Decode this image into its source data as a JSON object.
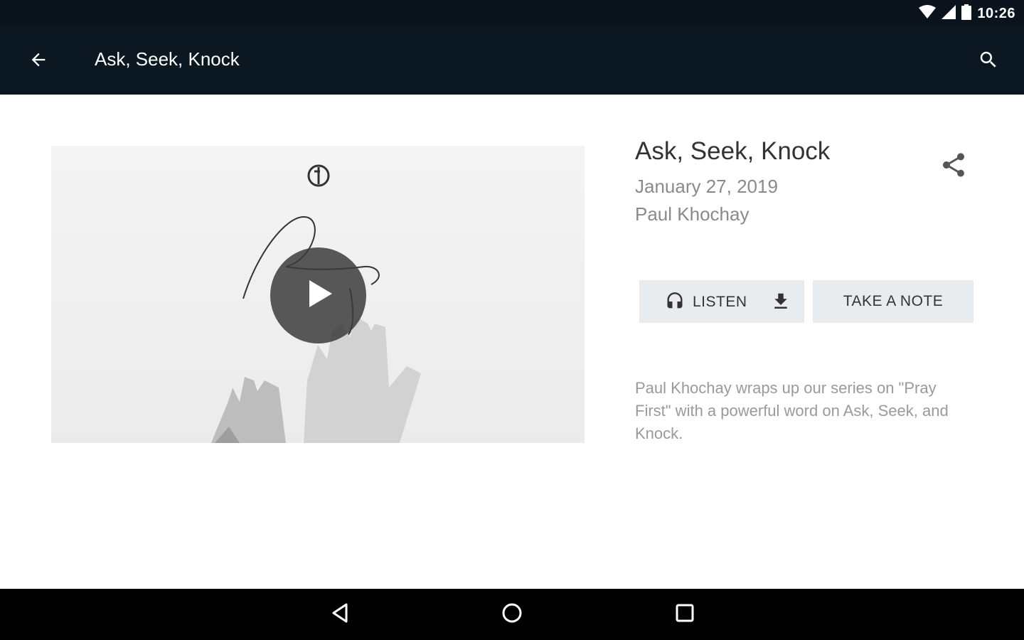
{
  "status_bar": {
    "time": "10:26",
    "icons": [
      "wifi-icon",
      "cell-signal-icon",
      "battery-icon"
    ]
  },
  "app_bar": {
    "title": "Ask, Seek, Knock",
    "back_icon": "arrow-back-icon",
    "search_icon": "search-icon"
  },
  "media": {
    "play_icon": "play-icon"
  },
  "sermon": {
    "title": "Ask, Seek, Knock",
    "date": "January 27, 2019",
    "speaker": "Paul Khochay",
    "share_icon": "share-icon",
    "description": "Paul Khochay wraps up our series on \"Pray First\" with a powerful word on Ask, Seek, and Knock."
  },
  "actions": {
    "listen_label": "LISTEN",
    "listen_icon": "headphones-icon",
    "download_icon": "download-icon",
    "note_label": "TAKE A NOTE"
  },
  "nav_bar": {
    "icons": [
      "nav-back-icon",
      "nav-home-icon",
      "nav-recents-icon"
    ]
  },
  "colors": {
    "app_bar": "#0b1821",
    "status_bar": "#0b141d",
    "button_bg": "#e9ecef",
    "title_text": "#333333",
    "secondary_text": "#8a8a8a"
  }
}
